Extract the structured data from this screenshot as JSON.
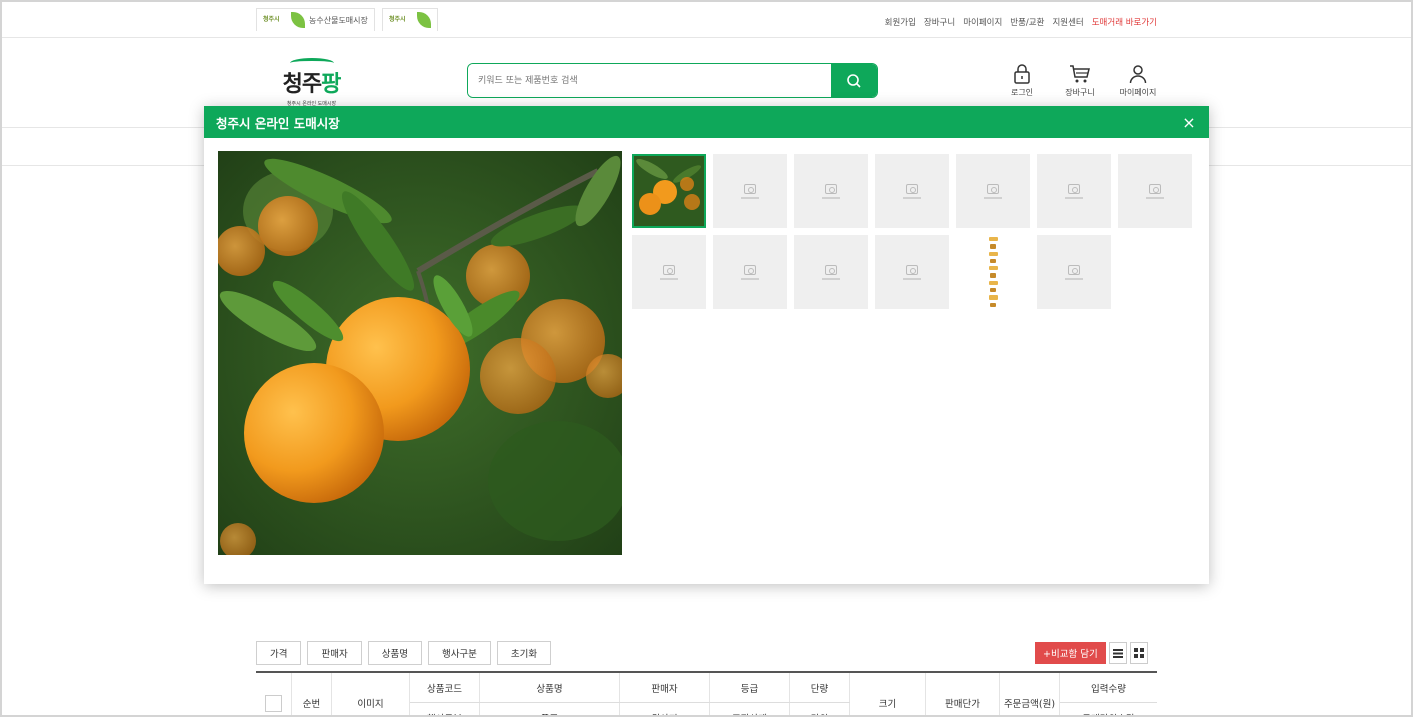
{
  "topbar": {
    "partner1_mini": "청주시",
    "partner1_label": "농수산물도매시장",
    "partner2_mini": "청주시",
    "links": [
      "회원가입",
      "장바구니",
      "마이페이지",
      "반품/교환",
      "지원센터"
    ],
    "highlight_link": "도매거래 바로가기"
  },
  "header": {
    "logo_main_a": "청주",
    "logo_main_b": "팡",
    "logo_sub": "청주시 온라인 도매시장",
    "search_placeholder": "키워드 또는 제품번호 검색",
    "icons": [
      {
        "name": "lock-icon",
        "label": "로그인"
      },
      {
        "name": "cart-icon",
        "label": "장바구니"
      },
      {
        "name": "user-icon",
        "label": "마이페이지"
      }
    ]
  },
  "filters": [
    "가격",
    "판매자",
    "상품명",
    "행사구분",
    "초기화"
  ],
  "compare_label": "+비교함 담기",
  "table": {
    "col_no": "순번",
    "col_image": "이미지",
    "top": [
      "상품코드",
      "상품명",
      "판매자",
      "등급",
      "단량"
    ],
    "bottom": [
      "행사구분",
      "품종",
      "원산지",
      "포장상태",
      "단위"
    ],
    "col_size": "크기",
    "col_price": "판매단가",
    "col_order": "주문금액(원)",
    "col_qty_top": "입력수량",
    "col_qty_bottom": "구매단위수량"
  },
  "modal": {
    "title": "청주시 온라인 도매시장",
    "close": "×",
    "thumbnails": [
      "photo",
      "empty",
      "empty",
      "empty",
      "empty",
      "empty",
      "empty",
      "empty",
      "empty",
      "empty",
      "empty",
      "strip",
      "empty"
    ]
  },
  "colors": {
    "brand_green": "#0ea85a",
    "compare_red": "#e14b4b",
    "link_red": "#e03a3a"
  }
}
